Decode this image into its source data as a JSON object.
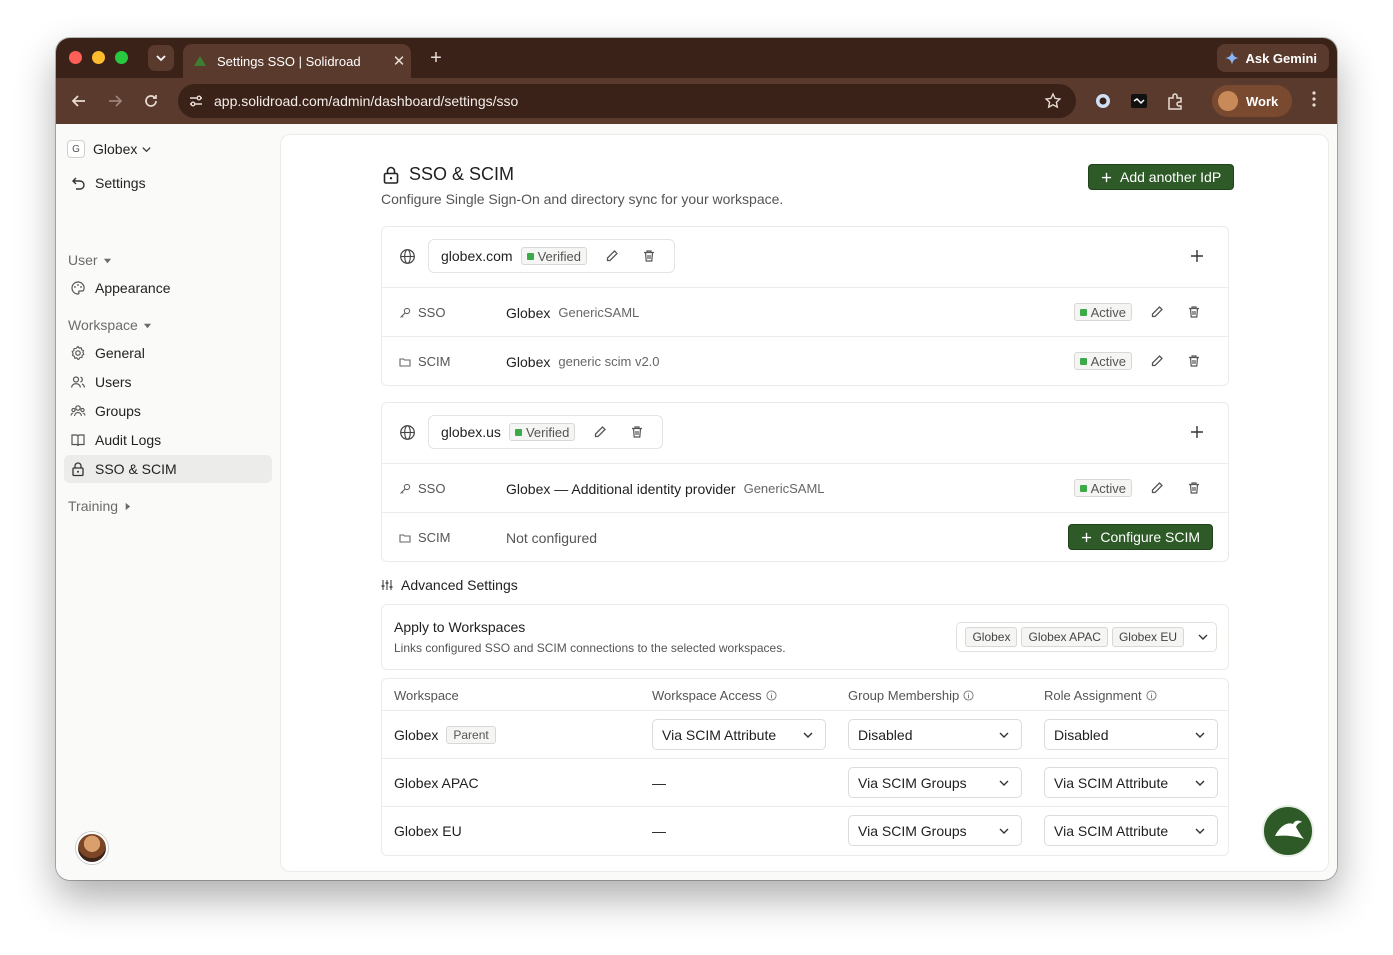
{
  "browser": {
    "tab_title": "Settings SSO | Solidroad",
    "url": "app.solidroad.com/admin/dashboard/settings/sso",
    "gemini_label": "Ask Gemini",
    "profile_label": "Work"
  },
  "sidebar": {
    "workspace_letter": "G",
    "workspace_name": "Globex",
    "back_label": "Settings",
    "section_user": "User",
    "appearance": "Appearance",
    "section_workspace": "Workspace",
    "general": "General",
    "users": "Users",
    "groups": "Groups",
    "audit_logs": "Audit Logs",
    "sso_scim": "SSO & SCIM",
    "section_training": "Training"
  },
  "header": {
    "title": "SSO & SCIM",
    "subtitle": "Configure Single Sign-On and directory sync for your workspace.",
    "add_idp": "Add another IdP"
  },
  "domains": [
    {
      "domain": "globex.com",
      "status": "Verified",
      "connections": [
        {
          "kind": "SSO",
          "name": "Globex",
          "protocol": "GenericSAML",
          "status": "Active"
        },
        {
          "kind": "SCIM",
          "name": "Globex",
          "protocol": "generic scim v2.0",
          "status": "Active"
        }
      ]
    },
    {
      "domain": "globex.us",
      "status": "Verified",
      "connections": [
        {
          "kind": "SSO",
          "name": "Globex — Additional identity provider",
          "protocol": "GenericSAML",
          "status": "Active"
        },
        {
          "kind": "SCIM",
          "name": "Not configured",
          "action": "Configure SCIM"
        }
      ]
    }
  ],
  "advanced": {
    "title": "Advanced Settings",
    "apply_title": "Apply to Workspaces",
    "apply_desc": "Links configured SSO and SCIM connections to the selected workspaces.",
    "selected": [
      "Globex",
      "Globex APAC",
      "Globex EU"
    ]
  },
  "table": {
    "columns": [
      "Workspace",
      "Workspace Access",
      "Group Membership",
      "Role Assignment"
    ],
    "rows": [
      {
        "workspace": "Globex",
        "tag": "Parent",
        "access": "Via SCIM Attribute",
        "group": "Disabled",
        "role": "Disabled"
      },
      {
        "workspace": "Globex APAC",
        "access": "—",
        "group": "Via SCIM Groups",
        "role": "Via SCIM Attribute"
      },
      {
        "workspace": "Globex EU",
        "access": "—",
        "group": "Via SCIM Groups",
        "role": "Via SCIM Attribute"
      }
    ]
  },
  "colors": {
    "accent_green": "#2d5a27",
    "status_green": "#3daa49",
    "chrome_dark": "#3a2218",
    "chrome_toolbar": "#5a3a2c"
  }
}
